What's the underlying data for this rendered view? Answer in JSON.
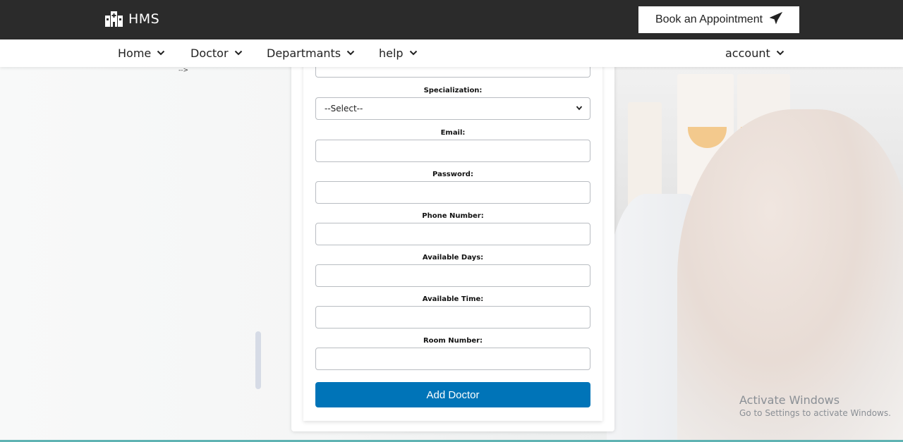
{
  "brand": {
    "name": "HMS",
    "icon": "hospital-icon"
  },
  "header": {
    "book_label": "Book an Appointment",
    "book_icon": "paper-plane-icon"
  },
  "nav": {
    "items": [
      {
        "label": "Home"
      },
      {
        "label": "Doctor"
      },
      {
        "label": "Departmants"
      },
      {
        "label": "help"
      }
    ],
    "account_label": "account"
  },
  "stray_text": "-->",
  "form": {
    "specialization_label": "Specialization:",
    "specialization_value": "--Select--",
    "email_label": "Email:",
    "password_label": "Password:",
    "phone_label": "Phone Number:",
    "days_label": "Available Days:",
    "time_label": "Available Time:",
    "room_label": "Room Number:",
    "submit_label": "Add Doctor"
  },
  "watermark": {
    "title": "Activate Windows",
    "subtitle": "Go to Settings to activate Windows."
  },
  "colors": {
    "topbar": "#2b2b2b",
    "primary_button": "#0074b8"
  }
}
